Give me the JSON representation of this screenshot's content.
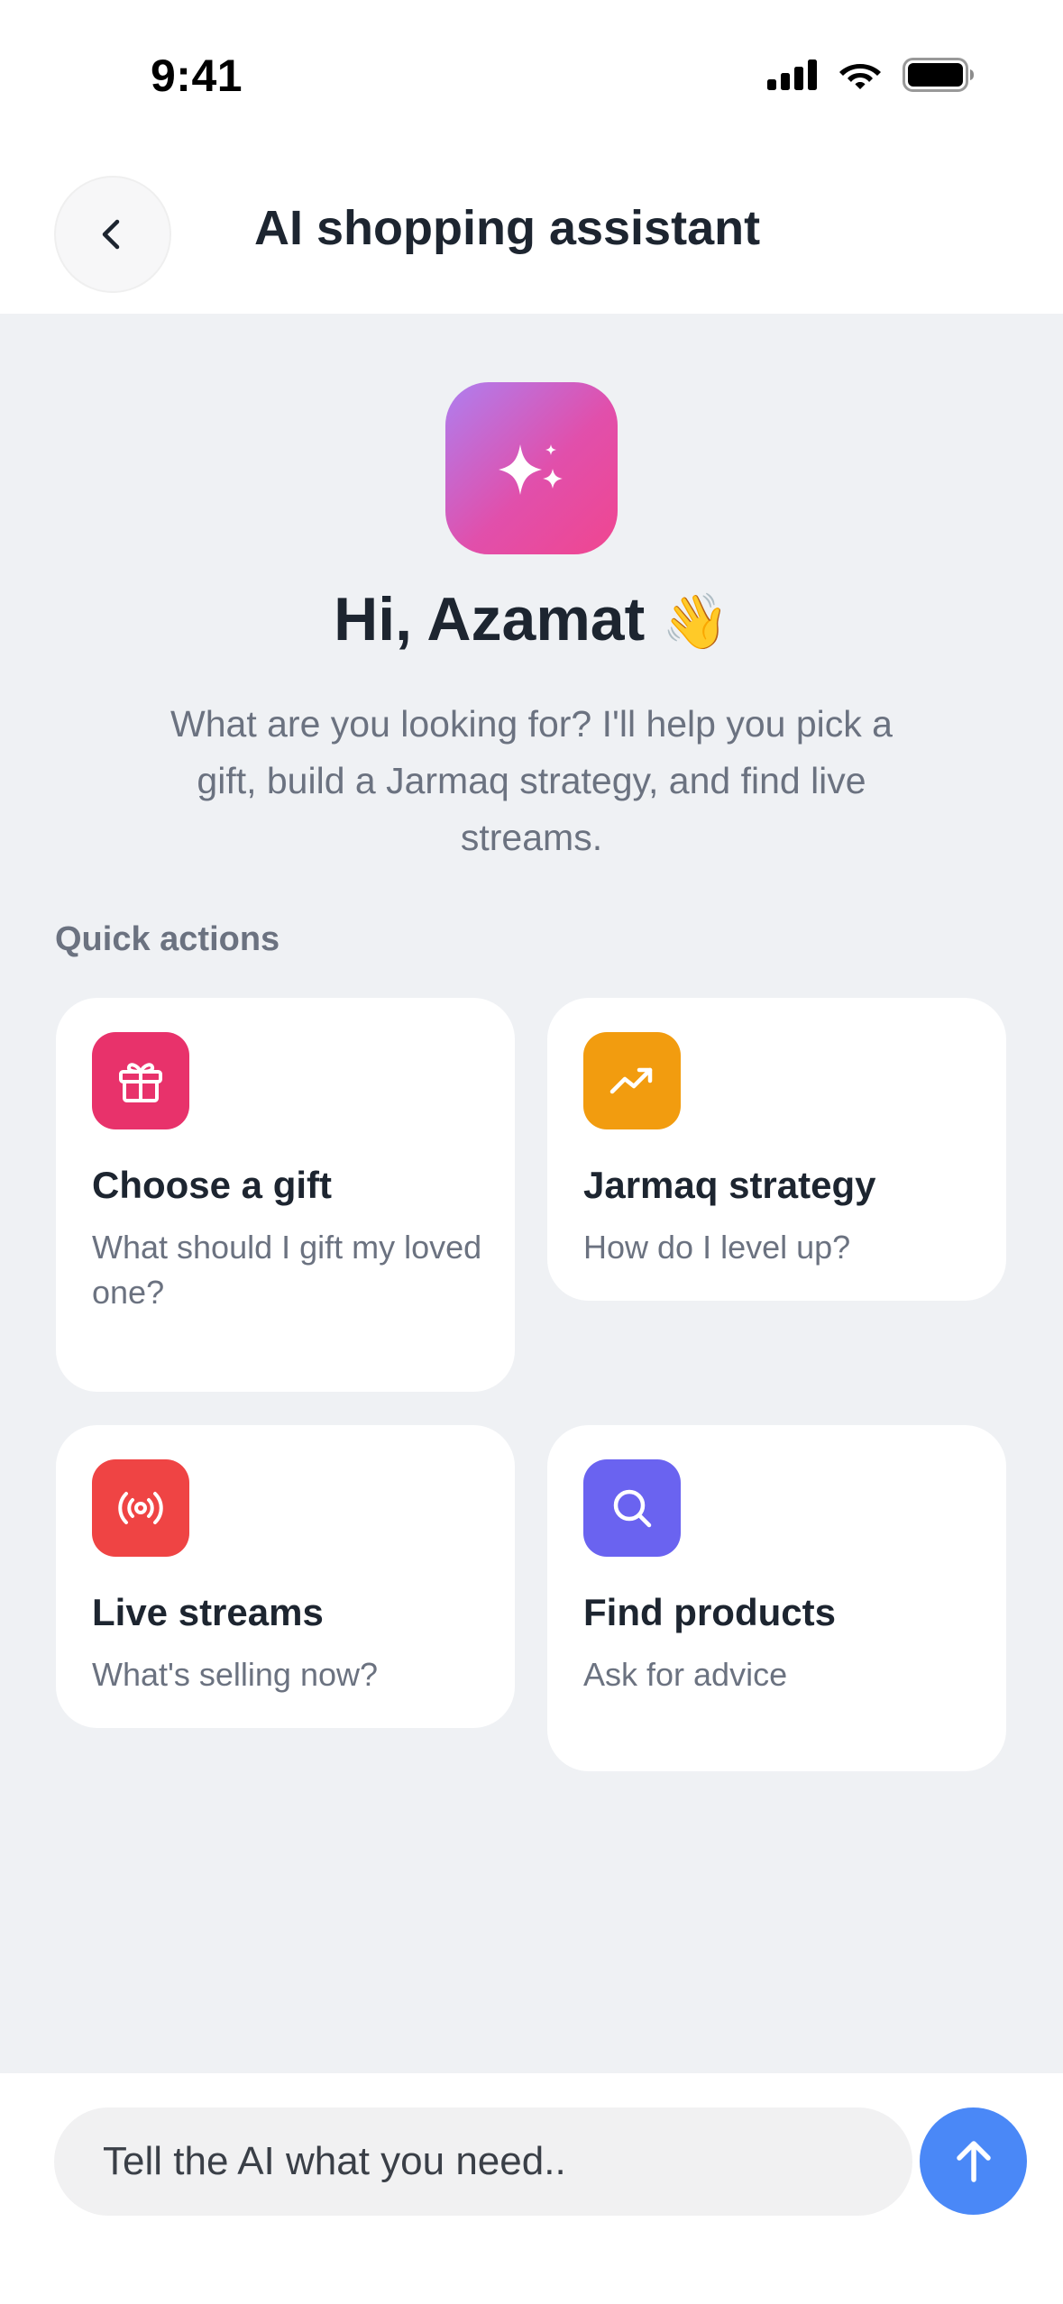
{
  "status_bar": {
    "time": "9:41"
  },
  "header": {
    "title": "AI shopping assistant",
    "back_icon": "chevron-left-icon"
  },
  "hero": {
    "icon": "sparkles-icon",
    "greeting": "Hi, Azamat",
    "greeting_emoji": "👋",
    "subtitle": "What are you looking for? I'll help you pick a gift, build a Jarmaq strategy, and find live streams."
  },
  "quick_actions": {
    "label": "Quick actions",
    "items": [
      {
        "icon": "gift-icon",
        "color": "#e8326b",
        "title": "Choose a gift",
        "subtitle": "What should I gift my loved one?"
      },
      {
        "icon": "trending-up-icon",
        "color": "#f29c0f",
        "title": "Jarmaq strategy",
        "subtitle": "How do I level up?"
      },
      {
        "icon": "broadcast-icon",
        "color": "#ef4444",
        "title": "Live streams",
        "subtitle": "What's selling now?"
      },
      {
        "icon": "search-icon",
        "color": "#6a63f0",
        "title": "Find products",
        "subtitle": "Ask for advice"
      }
    ]
  },
  "composer": {
    "placeholder": "Tell the AI what you need..",
    "send_icon": "arrow-up-icon",
    "send_color": "#4a88f7"
  }
}
